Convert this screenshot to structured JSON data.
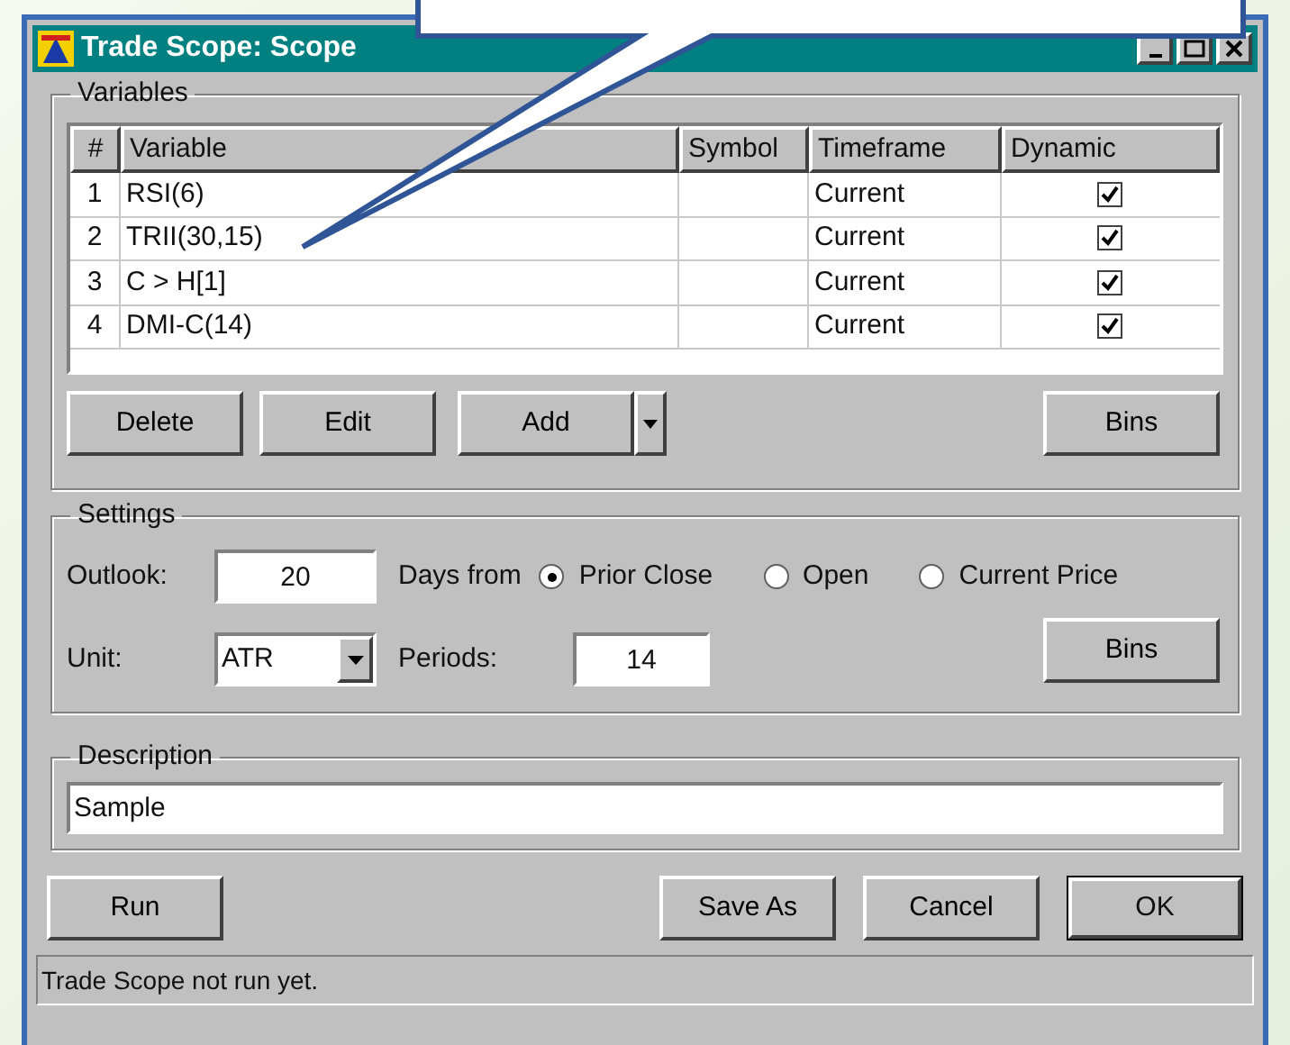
{
  "window": {
    "title": "Trade Scope: Scope"
  },
  "variables": {
    "legend": "Variables",
    "columns": [
      "#",
      "Variable",
      "Symbol",
      "Timeframe",
      "Dynamic"
    ],
    "rows": [
      {
        "num": "1",
        "variable": "RSI(6)",
        "symbol": "",
        "timeframe": "Current",
        "dynamic": true
      },
      {
        "num": "2",
        "variable": "TRII(30,15)",
        "symbol": "",
        "timeframe": "Current",
        "dynamic": true
      },
      {
        "num": "3",
        "variable": "C > H[1]",
        "symbol": "",
        "timeframe": "Current",
        "dynamic": true
      },
      {
        "num": "4",
        "variable": "DMI-C(14)",
        "symbol": "",
        "timeframe": "Current",
        "dynamic": true
      }
    ],
    "buttons": [
      "Delete",
      "Edit",
      "Add"
    ],
    "bins": "Bins"
  },
  "settings": {
    "legend": "Settings",
    "outlook_label": "Outlook:",
    "outlook": "20",
    "days_from": "Days from",
    "options": [
      {
        "label": "Prior Close",
        "selected": true
      },
      {
        "label": "Open",
        "selected": false
      },
      {
        "label": "Current Price",
        "selected": false
      }
    ],
    "unit_label": "Unit:",
    "unit": "ATR",
    "periods_label": "Periods:",
    "periods": "14",
    "bins": "Bins"
  },
  "description": {
    "legend": "Description",
    "value": "Sample"
  },
  "buttons": {
    "run": "Run",
    "save_as": "Save As",
    "cancel": "Cancel",
    "ok": "OK"
  },
  "status_bar": "Trade Scope not run yet."
}
